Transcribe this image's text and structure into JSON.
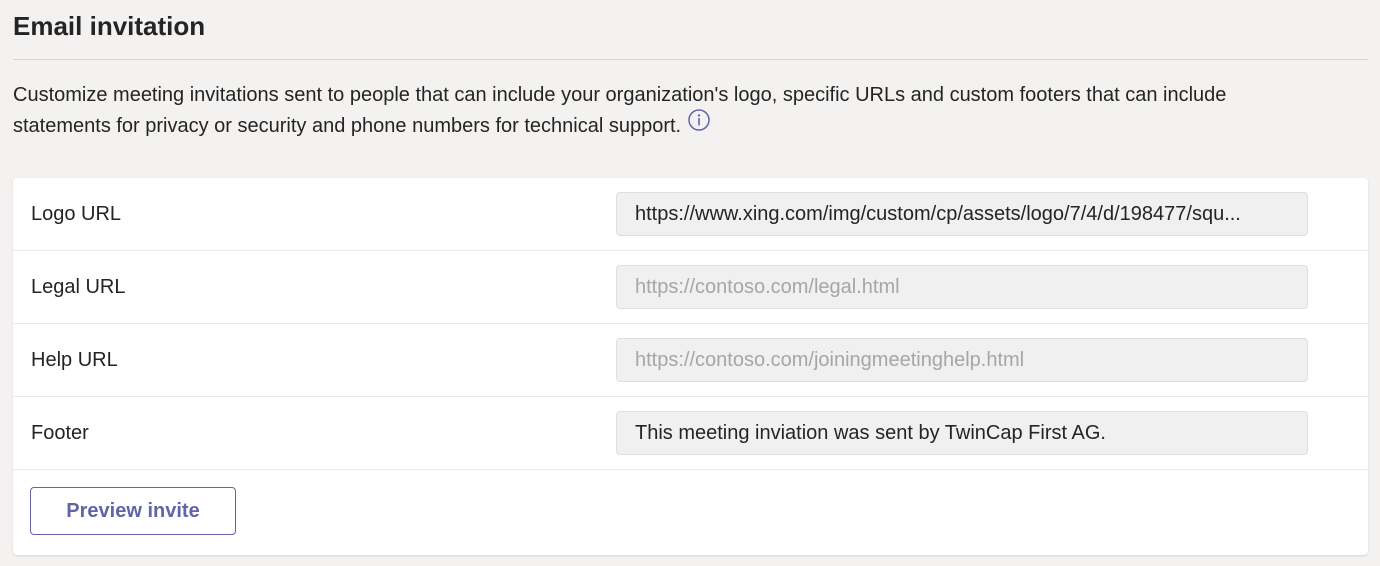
{
  "section": {
    "title": "Email invitation",
    "description": "Customize meeting invitations sent to people that can include your organization's logo, specific URLs and custom footers that can include statements for privacy or security and phone numbers for technical support.",
    "info_icon": "info-circle-icon"
  },
  "fields": [
    {
      "label": "Logo URL",
      "value": "https://www.xing.com/img/custom/cp/assets/logo/7/4/d/198477/squ...",
      "placeholder": ""
    },
    {
      "label": "Legal URL",
      "value": "",
      "placeholder": "https://contoso.com/legal.html"
    },
    {
      "label": "Help URL",
      "value": "",
      "placeholder": "https://contoso.com/joiningmeetinghelp.html"
    },
    {
      "label": "Footer",
      "value": "This meeting inviation was sent by TwinCap First AG.",
      "placeholder": ""
    }
  ],
  "actions": {
    "preview_label": "Preview invite"
  },
  "colors": {
    "accent": "#6264a7",
    "background": "#f3f2f1",
    "card": "#ffffff",
    "field_background": "#f0f0f0"
  }
}
